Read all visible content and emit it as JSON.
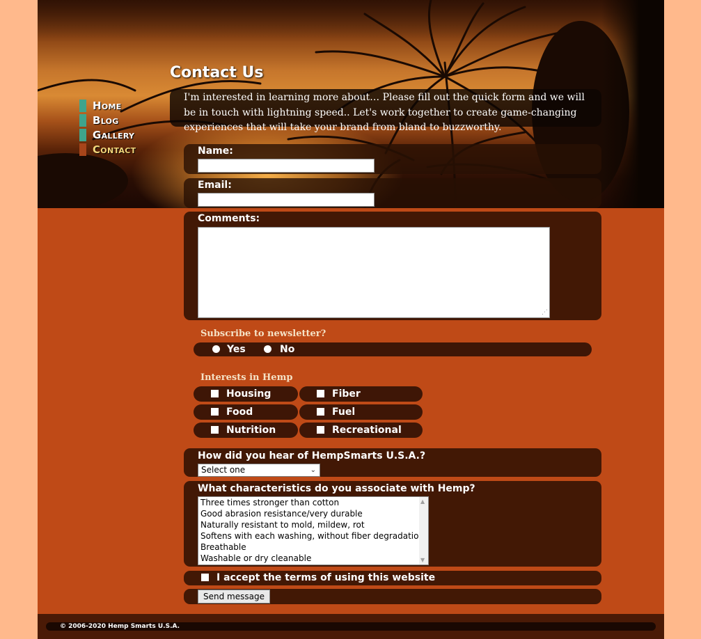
{
  "nav": {
    "items": [
      {
        "label": "Home"
      },
      {
        "label": "Blog"
      },
      {
        "label": "Gallery"
      },
      {
        "label": "Contact"
      }
    ],
    "active": "Contact"
  },
  "page": {
    "title": "Contact Us",
    "intro": "I'm interested in learning more about… Please fill out the quick form and we will be in touch with lightning speed.. Let's work together to create game-changing experiences that will take your brand from bland to buzzworthy."
  },
  "form": {
    "name_label": "Name:",
    "name_value": "",
    "email_label": "Email:",
    "email_value": "",
    "comments_label": "Comments:",
    "comments_value": "",
    "newsletter": {
      "label": "Subscribe to newsletter?",
      "yes": "Yes",
      "no": "No"
    },
    "interests": {
      "label": "Interests in Hemp",
      "options": [
        "Housing",
        "Fiber",
        "Food",
        "Fuel",
        "Nutrition",
        "Recreational"
      ]
    },
    "hear": {
      "label": "How did you hear of HempSmarts U.S.A.?",
      "selected": "Select one"
    },
    "characteristics": {
      "label": "What characteristics do you associate with Hemp?",
      "options": [
        "Three times stronger than cotton",
        "Good abrasion resistance/very durable",
        "Naturally resistant to mold, mildew, rot",
        "Softens with each washing, without fiber degradation",
        "Breathable",
        "Washable or dry cleanable"
      ]
    },
    "terms_label": "I accept the terms of using this website",
    "submit_label": "Send message"
  },
  "footer": {
    "copyright": "© 2006-2020 Hemp Smarts U.S.A."
  },
  "colors": {
    "page_bg": "#ffb98c",
    "content_bg": "#bf4a17",
    "panel_bg": "#3c1605",
    "nav_bar": "#3fa48c",
    "nav_active_bar": "#a8451a",
    "nav_active_text": "#f2d57a"
  }
}
